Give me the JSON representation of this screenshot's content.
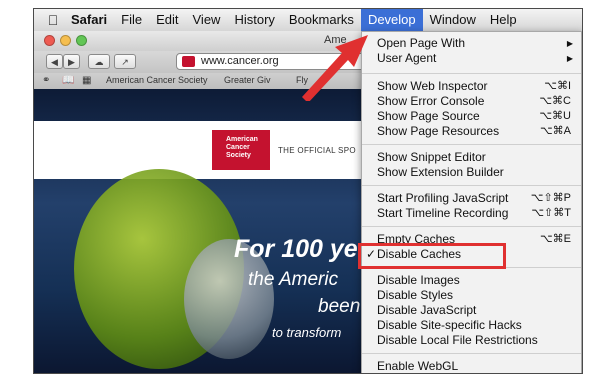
{
  "menubar": {
    "app": "Safari",
    "items": [
      "File",
      "Edit",
      "View",
      "History",
      "Bookmarks",
      "Develop",
      "Window",
      "Help"
    ]
  },
  "window": {
    "title": "Ame",
    "url": "www.cancer.org",
    "bookmarks": [
      "American Cancer Society",
      "Greater Giv",
      "Fly"
    ]
  },
  "page": {
    "logo_text": "American Cancer Society",
    "tagline": "THE OFFICIAL SPO",
    "hero_line1": "For 100 ye",
    "hero_line2": "the Americ",
    "hero_line3": "been",
    "hero_line4": "to transform"
  },
  "develop_menu": {
    "items": [
      {
        "label": "Open Page With",
        "submenu": true
      },
      {
        "label": "User Agent",
        "submenu": true
      },
      {
        "label": "Show Web Inspector",
        "shortcut": "⌥⌘I"
      },
      {
        "label": "Show Error Console",
        "shortcut": "⌥⌘C"
      },
      {
        "label": "Show Page Source",
        "shortcut": "⌥⌘U"
      },
      {
        "label": "Show Page Resources",
        "shortcut": "⌥⌘A"
      },
      {
        "label": "Show Snippet Editor"
      },
      {
        "label": "Show Extension Builder"
      },
      {
        "label": "Start Profiling JavaScript",
        "shortcut": "⌥⇧⌘P"
      },
      {
        "label": "Start Timeline Recording",
        "shortcut": "⌥⇧⌘T"
      },
      {
        "label": "Empty Caches",
        "shortcut": "⌥⌘E"
      },
      {
        "label": "Disable Caches",
        "checked": true
      },
      {
        "label": "Disable Images"
      },
      {
        "label": "Disable Styles"
      },
      {
        "label": "Disable JavaScript"
      },
      {
        "label": "Disable Site-specific Hacks"
      },
      {
        "label": "Disable Local File Restrictions"
      },
      {
        "label": "Enable WebGL"
      }
    ],
    "checkmark": "✓",
    "submenu_arrow": "▶"
  },
  "colors": {
    "menu_highlight": "#3b6fd6",
    "annotation_red": "#e03030",
    "brand_red": "#c4122f"
  }
}
